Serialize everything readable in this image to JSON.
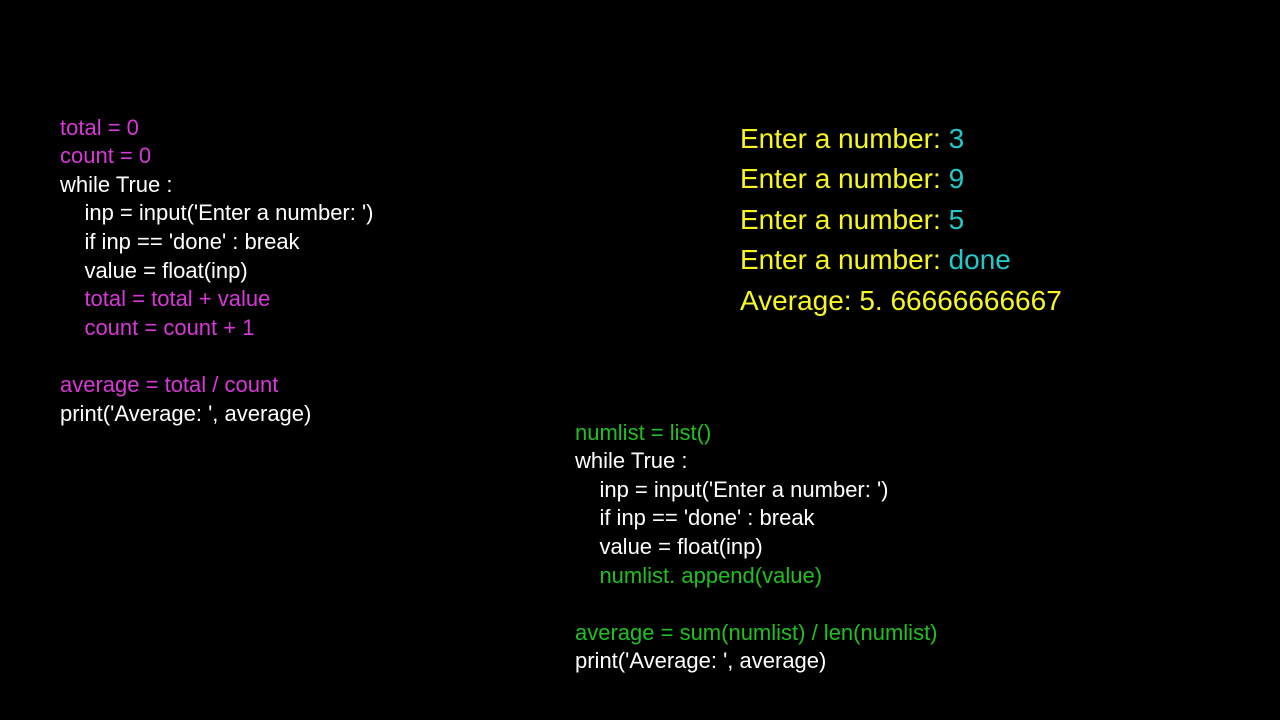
{
  "left_code": {
    "l1": "total = 0",
    "l2": "count = 0",
    "l3": "while True :",
    "l4": "    inp = input('Enter a number: ')",
    "l5": "    if inp == 'done' : break",
    "l6": "    value = float(inp)",
    "l7": "    total = total + value",
    "l8": "    count = count + 1",
    "l9": "",
    "l10": "average = total / count",
    "l11": "print('Average: ', average)"
  },
  "output": {
    "prompt1": "Enter a number: ",
    "val1": "3",
    "prompt2": "Enter a number: ",
    "val2": "9",
    "prompt3": "Enter a number: ",
    "val3": "5",
    "prompt4": "Enter a number: ",
    "val4": "done",
    "avg_label": "Average: ",
    "avg_value": "5. 66666666667"
  },
  "right_code": {
    "l1": "numlist = list()",
    "l2": "while True :",
    "l3": "    inp = input('Enter a number: ')",
    "l4": "    if inp == 'done' : break",
    "l5": "    value = float(inp)",
    "l6": "    numlist. append(value)",
    "l7": "",
    "l8": "average = sum(numlist) / len(numlist)",
    "l9": "print('Average: ', average)"
  }
}
